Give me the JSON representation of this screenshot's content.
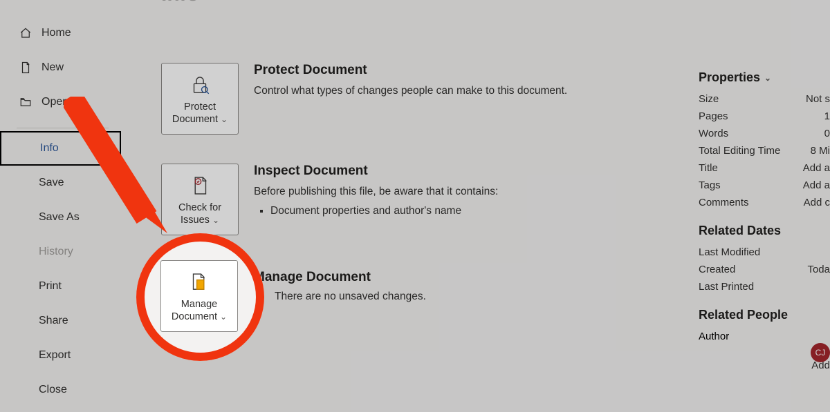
{
  "page_title": "Info",
  "sidebar": {
    "items": [
      {
        "label": "Home",
        "icon": "home-icon",
        "withIcon": true
      },
      {
        "label": "New",
        "icon": "new-icon",
        "withIcon": true
      },
      {
        "label": "Open",
        "icon": "open-icon",
        "withIcon": true
      },
      {
        "label": "Info",
        "selected": true
      },
      {
        "label": "Save"
      },
      {
        "label": "Save As"
      },
      {
        "label": "History",
        "disabled": true
      },
      {
        "label": "Print"
      },
      {
        "label": "Share"
      },
      {
        "label": "Export"
      },
      {
        "label": "Close"
      }
    ]
  },
  "sections": {
    "protect": {
      "button_line1": "Protect",
      "button_line2": "Document",
      "heading": "Protect Document",
      "desc": "Control what types of changes people can make to this document."
    },
    "inspect": {
      "button_line1": "Check for",
      "button_line2": "Issues",
      "heading": "Inspect Document",
      "desc": "Before publishing this file, be aware that it contains:",
      "bullets": [
        "Document properties and author's name"
      ]
    },
    "manage": {
      "button_line1": "Manage",
      "button_line2": "Document",
      "heading": "Manage Document",
      "status": "There are no unsaved changes."
    }
  },
  "properties": {
    "heading": "Properties",
    "rows": [
      {
        "k": "Size",
        "v": "Not s"
      },
      {
        "k": "Pages",
        "v": "1"
      },
      {
        "k": "Words",
        "v": "0"
      },
      {
        "k": "Total Editing Time",
        "v": "8 Mi"
      },
      {
        "k": "Title",
        "v": "Add a"
      },
      {
        "k": "Tags",
        "v": "Add a"
      },
      {
        "k": "Comments",
        "v": "Add c"
      }
    ],
    "dates_heading": "Related Dates",
    "dates": [
      {
        "k": "Last Modified",
        "v": ""
      },
      {
        "k": "Created",
        "v": "Toda"
      },
      {
        "k": "Last Printed",
        "v": ""
      }
    ],
    "people_heading": "Related People",
    "author_label": "Author",
    "avatar_initials": "CJ",
    "add_label": "Add"
  }
}
